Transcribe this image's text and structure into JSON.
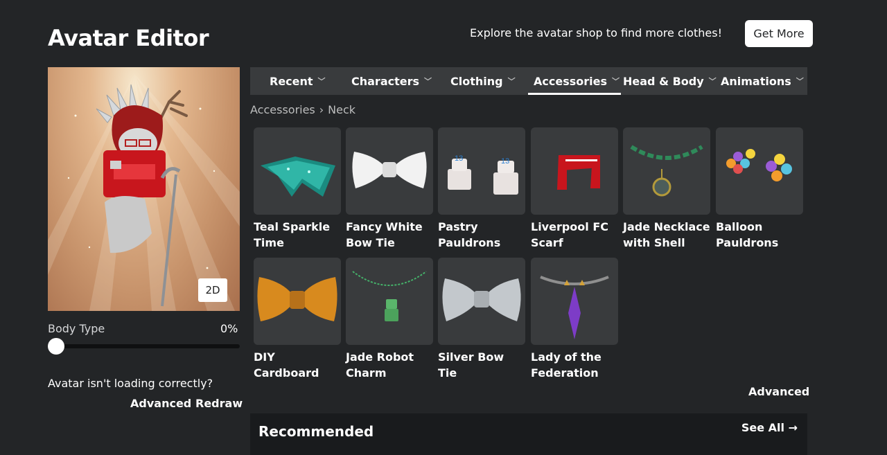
{
  "header": {
    "title": "Avatar Editor",
    "promo_text": "Explore the avatar shop to find more clothes!",
    "get_more_label": "Get More"
  },
  "preview": {
    "view_toggle_label": "2D",
    "body_type_label": "Body Type",
    "body_type_value": "0%",
    "body_type_fraction": 0,
    "loading_question": "Avatar isn't loading correctly?",
    "advanced_label": "Advanced",
    "redraw_label": "Redraw"
  },
  "tabs": [
    {
      "label": "Recent",
      "has_chevron": true
    },
    {
      "label": "Characters",
      "has_chevron": true
    },
    {
      "label": "Clothing",
      "has_chevron": true
    },
    {
      "label": "Accessories",
      "has_chevron": true,
      "active": true
    },
    {
      "label": "Head & Body",
      "has_chevron": true
    },
    {
      "label": "Animations",
      "has_chevron": true
    }
  ],
  "breadcrumb": {
    "parent": "Accessories",
    "separator": "›",
    "current": "Neck"
  },
  "items": [
    {
      "name": "Teal Sparkle Time",
      "icon": "teal-sparkle-icon"
    },
    {
      "name": "Fancy White Bow Tie",
      "icon": "white-bow-tie-icon"
    },
    {
      "name": "Pastry Pauldrons",
      "icon": "cake-pauldrons-icon"
    },
    {
      "name": "Liverpool FC Scarf",
      "icon": "scarf-icon"
    },
    {
      "name": "Jade Necklace with Shell",
      "icon": "jade-necklace-icon"
    },
    {
      "name": "Balloon Pauldrons",
      "icon": "balloons-icon"
    },
    {
      "name": "DIY Cardboard",
      "icon": "cardboard-bow-icon"
    },
    {
      "name": "Jade Robot Charm",
      "icon": "robot-charm-icon"
    },
    {
      "name": "Silver Bow Tie",
      "icon": "silver-bow-tie-icon"
    },
    {
      "name": "Lady of the Federation",
      "icon": "federation-necklace-icon"
    }
  ],
  "advanced_label": "Advanced",
  "recommended": {
    "title": "Recommended",
    "see_all_label": "See All →"
  },
  "colors": {
    "background": "#232527",
    "panel": "#393b3d",
    "tile": "#393b3d",
    "accent": "#ffffff"
  }
}
